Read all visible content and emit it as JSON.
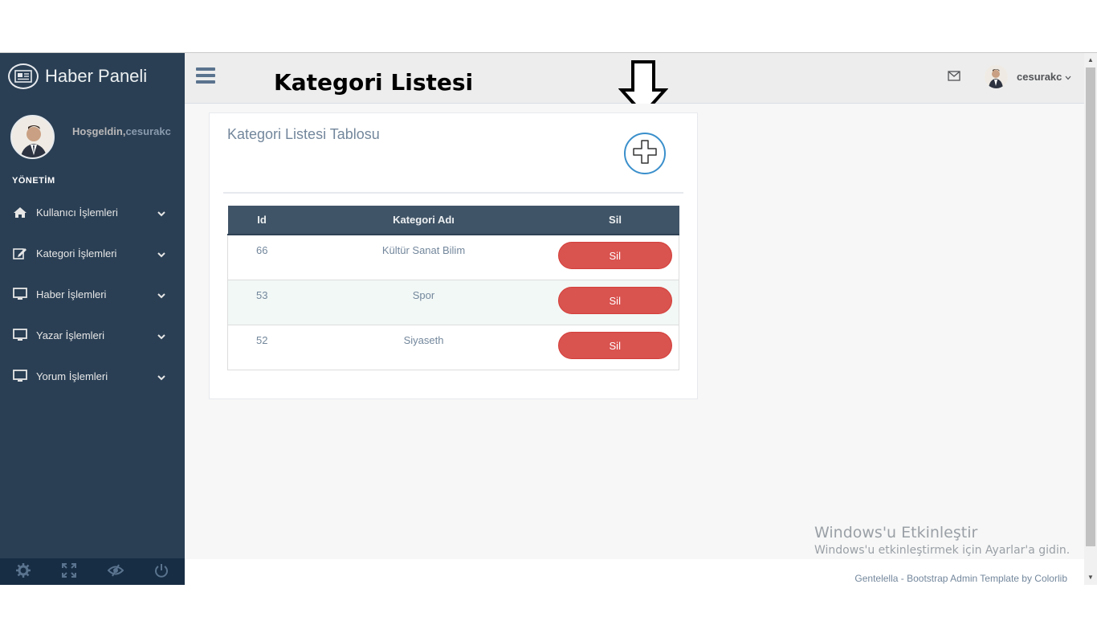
{
  "sidebar": {
    "brand": "Haber Paneli",
    "welcome_prefix": "Hoşgeldin,",
    "username": "cesurakc",
    "menu_heading": "YÖNETİM",
    "items": [
      {
        "label": "Kullanıcı İşlemleri",
        "icon": "home-icon"
      },
      {
        "label": "Kategori İşlemleri",
        "icon": "edit-icon"
      },
      {
        "label": "Haber İşlemleri",
        "icon": "desktop-icon"
      },
      {
        "label": "Yazar İşlemleri",
        "icon": "desktop-icon"
      },
      {
        "label": "Yorum İşlemleri",
        "icon": "desktop-icon"
      }
    ],
    "footer_icons": [
      "settings-icon",
      "fullscreen-icon",
      "hide-icon",
      "power-icon"
    ]
  },
  "header": {
    "title": "Kategori Listesi",
    "username": "cesurakc"
  },
  "panel": {
    "title": "Kategori Listesi Tablosu",
    "table": {
      "columns": [
        "Id",
        "Kategori Adı",
        "Sil"
      ],
      "rows": [
        {
          "id": "66",
          "name": "Kültür Sanat Bilim",
          "action": "Sil"
        },
        {
          "id": "53",
          "name": "Spor",
          "action": "Sil"
        },
        {
          "id": "52",
          "name": "Siyaseth",
          "action": "Sil"
        }
      ]
    }
  },
  "watermark": {
    "line1": "Windows'u Etkinleştir",
    "line2": "Windows'u etkinleştirmek için Ayarlar'a gidin."
  },
  "footer": {
    "text": "Gentelella - Bootstrap Admin Template by Colorlib"
  },
  "colors": {
    "sidebar_bg": "#2a3f54",
    "danger": "#d9534f",
    "table_header": "#405467",
    "accent": "#3a8fcb"
  }
}
